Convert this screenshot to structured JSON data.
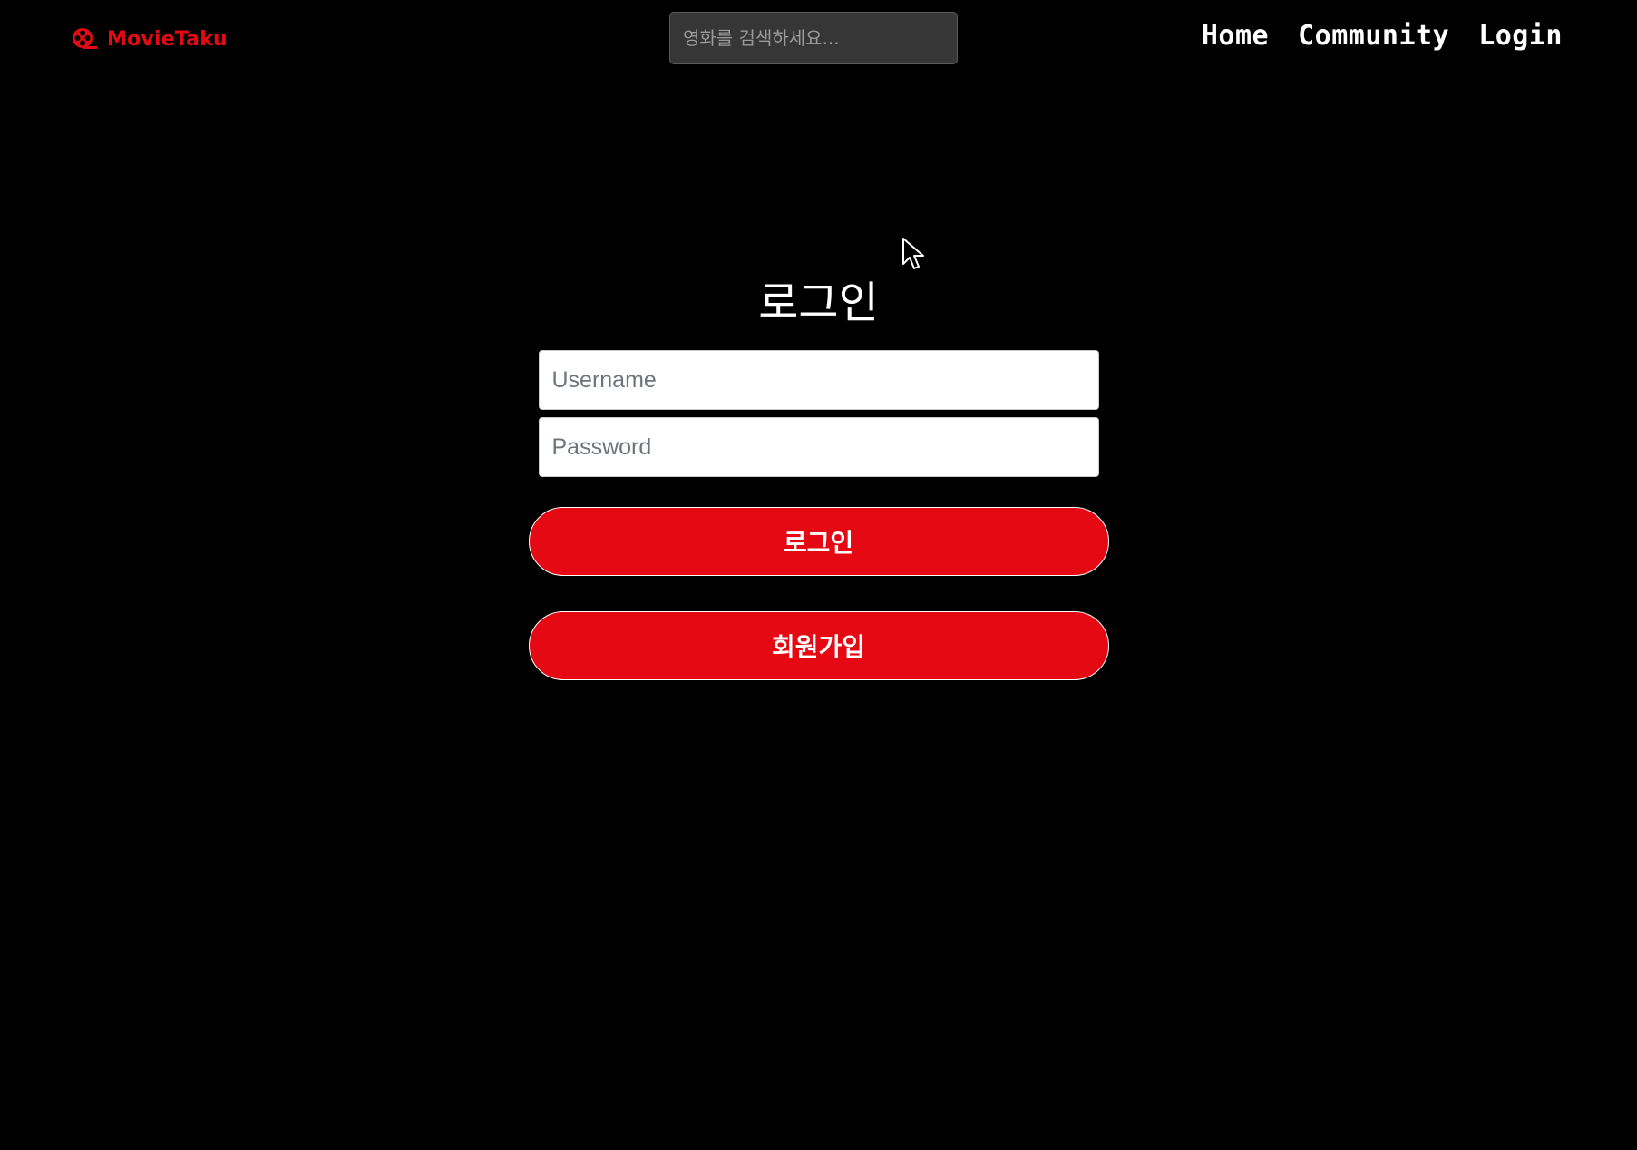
{
  "navbar": {
    "brand": {
      "name": "MovieTaku",
      "icon": "film-reel-icon",
      "color": "#e50914"
    },
    "search": {
      "placeholder": "영화를 검색하세요...",
      "value": ""
    },
    "links": [
      {
        "label": "Home"
      },
      {
        "label": "Community"
      },
      {
        "label": "Login"
      }
    ]
  },
  "login": {
    "title": "로그인",
    "username_placeholder": "Username",
    "password_placeholder": "Password",
    "login_button": "로그인",
    "signup_button": "회원가입"
  },
  "colors": {
    "background": "#000000",
    "accent": "#e50914",
    "text": "#ffffff"
  }
}
